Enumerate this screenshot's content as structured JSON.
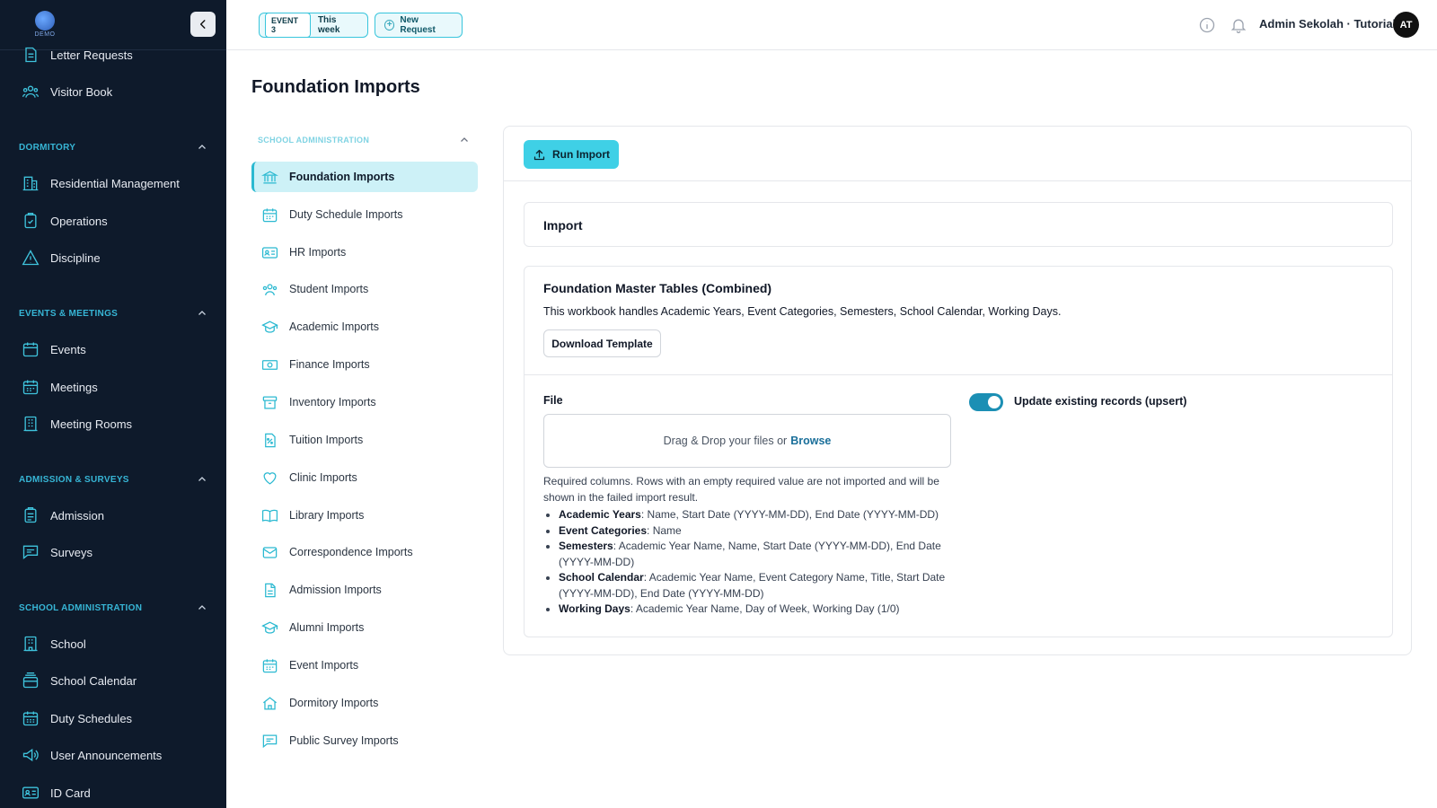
{
  "sidebar": {
    "logo_text": "DEMO",
    "items_top": [
      {
        "label": "Letter Requests",
        "icon": "letter-icon"
      },
      {
        "label": "Visitor Book",
        "icon": "visitors-icon"
      }
    ],
    "sections": [
      {
        "title": "Dormitory",
        "items": [
          {
            "label": "Residential Management",
            "icon": "building-icon"
          },
          {
            "label": "Operations",
            "icon": "clipboard-check-icon"
          },
          {
            "label": "Discipline",
            "icon": "warning-icon"
          }
        ]
      },
      {
        "title": "Events & Meetings",
        "items": [
          {
            "label": "Events",
            "icon": "calendar-icon"
          },
          {
            "label": "Meetings",
            "icon": "calendar-grid-icon"
          },
          {
            "label": "Meeting Rooms",
            "icon": "room-icon"
          }
        ]
      },
      {
        "title": "Admission & Surveys",
        "items": [
          {
            "label": "Admission",
            "icon": "clipboard-icon"
          },
          {
            "label": "Surveys",
            "icon": "chat-icon"
          }
        ]
      },
      {
        "title": "School Administration",
        "items": [
          {
            "label": "School",
            "icon": "school-icon"
          },
          {
            "label": "School Calendar",
            "icon": "calendar-stack-icon"
          },
          {
            "label": "Duty Schedules",
            "icon": "schedule-icon"
          },
          {
            "label": "User Announcements",
            "icon": "megaphone-icon"
          },
          {
            "label": "ID Card",
            "icon": "id-card-icon"
          }
        ]
      }
    ]
  },
  "topbar": {
    "event_badge": "EVENT 3",
    "event_period": "This week",
    "new_request": "New Request",
    "user_name": "Admin Sekolah · Tutorial",
    "avatar_initials": "AT"
  },
  "page": {
    "title": "Foundation Imports"
  },
  "subnav": {
    "header": "School Administration",
    "items": [
      {
        "label": "Foundation Imports",
        "icon": "bank-icon",
        "active": true
      },
      {
        "label": "Duty Schedule Imports",
        "icon": "calendar-icon"
      },
      {
        "label": "HR Imports",
        "icon": "id-card-icon"
      },
      {
        "label": "Student Imports",
        "icon": "people-icon"
      },
      {
        "label": "Academic Imports",
        "icon": "graduation-icon"
      },
      {
        "label": "Finance Imports",
        "icon": "money-icon"
      },
      {
        "label": "Inventory Imports",
        "icon": "archive-icon"
      },
      {
        "label": "Tuition Imports",
        "icon": "percent-doc-icon"
      },
      {
        "label": "Clinic Imports",
        "icon": "heart-icon"
      },
      {
        "label": "Library Imports",
        "icon": "book-icon"
      },
      {
        "label": "Correspondence Imports",
        "icon": "mail-icon"
      },
      {
        "label": "Admission Imports",
        "icon": "document-icon"
      },
      {
        "label": "Alumni Imports",
        "icon": "graduation-icon"
      },
      {
        "label": "Event Imports",
        "icon": "calendar-grid-icon"
      },
      {
        "label": "Dormitory Imports",
        "icon": "home-icon"
      },
      {
        "label": "Public Survey Imports",
        "icon": "chat-icon"
      }
    ]
  },
  "card": {
    "run_import": "Run Import",
    "import_title": "Import",
    "main_title": "Foundation Master Tables (Combined)",
    "main_desc": "This workbook handles Academic Years, Event Categories, Semesters, School Calendar, Working Days.",
    "download_template": "Download Template",
    "file_label": "File",
    "dropzone_text": "Drag & Drop your files or",
    "dropzone_link": "Browse",
    "required_note": "Required columns. Rows with an empty required value are not imported and will be shown in the failed import result.",
    "required_columns": [
      {
        "name": "Academic Years",
        "cols": ": Name, Start Date (YYYY-MM-DD), End Date (YYYY-MM-DD)"
      },
      {
        "name": "Event Categories",
        "cols": ": Name"
      },
      {
        "name": "Semesters",
        "cols": ": Academic Year Name, Name, Start Date (YYYY-MM-DD), End Date (YYYY-MM-DD)"
      },
      {
        "name": "School Calendar",
        "cols": ": Academic Year Name, Event Category Name, Title, Start Date (YYYY-MM-DD), End Date (YYYY-MM-DD)"
      },
      {
        "name": "Working Days",
        "cols": ": Academic Year Name, Day of Week, Working Day (1/0)"
      }
    ],
    "upsert_label": "Update existing records (upsert)",
    "upsert_on": true
  },
  "colors": {
    "sidebar_bg": "#0e1a2b",
    "accent": "#3fd0e6",
    "section_title": "#37b6d6",
    "toggle_on": "#1b8fb4",
    "link": "#1a6f9a"
  }
}
